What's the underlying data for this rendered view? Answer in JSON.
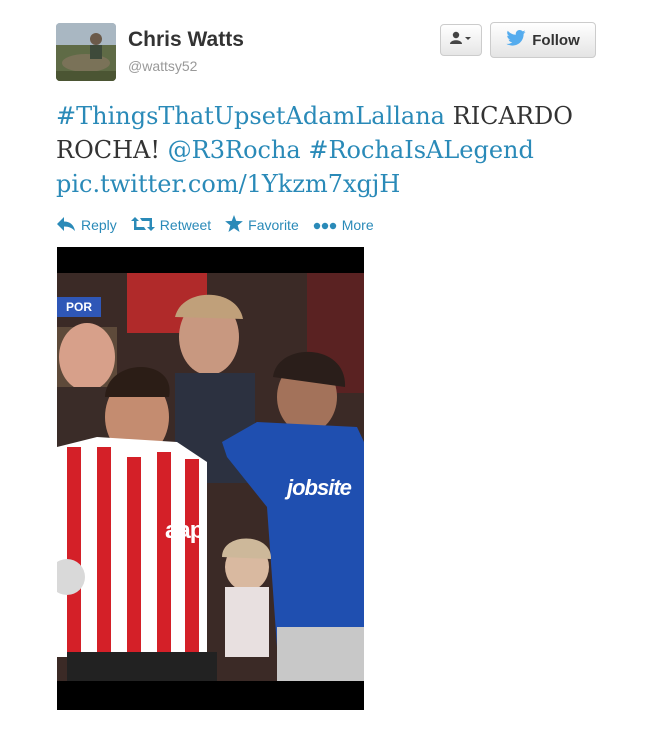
{
  "user": {
    "full_name": "Chris Watts",
    "username": "@wattsy52"
  },
  "buttons": {
    "follow_label": "Follow"
  },
  "tweet": {
    "hashtag1": "#ThingsThatUpsetAdamLallana",
    "plain_text": " RICARDO ROCHA! ",
    "mention": "@R3Rocha",
    "hashtag2": "#RochaIsALegend",
    "link": "pic.twitter.com/1Ykzm7xgjH"
  },
  "actions": {
    "reply": "Reply",
    "retweet": "Retweet",
    "favorite": "Favorite",
    "more": "More"
  },
  "photo": {
    "score_badge": "POR",
    "sponsor_left": "aap",
    "sponsor_right": "jobsite"
  },
  "colors": {
    "link": "#2a8ab8",
    "twitter_bird": "#55acee",
    "text": "#333333",
    "muted": "#999999"
  },
  "icons": {
    "avatar": "profile-photo",
    "user_dropdown": "user-silhouette-icon",
    "follow": "twitter-bird-icon",
    "reply": "reply-arrow-icon",
    "retweet": "retweet-icon",
    "favorite": "star-icon",
    "more": "ellipsis-icon"
  }
}
